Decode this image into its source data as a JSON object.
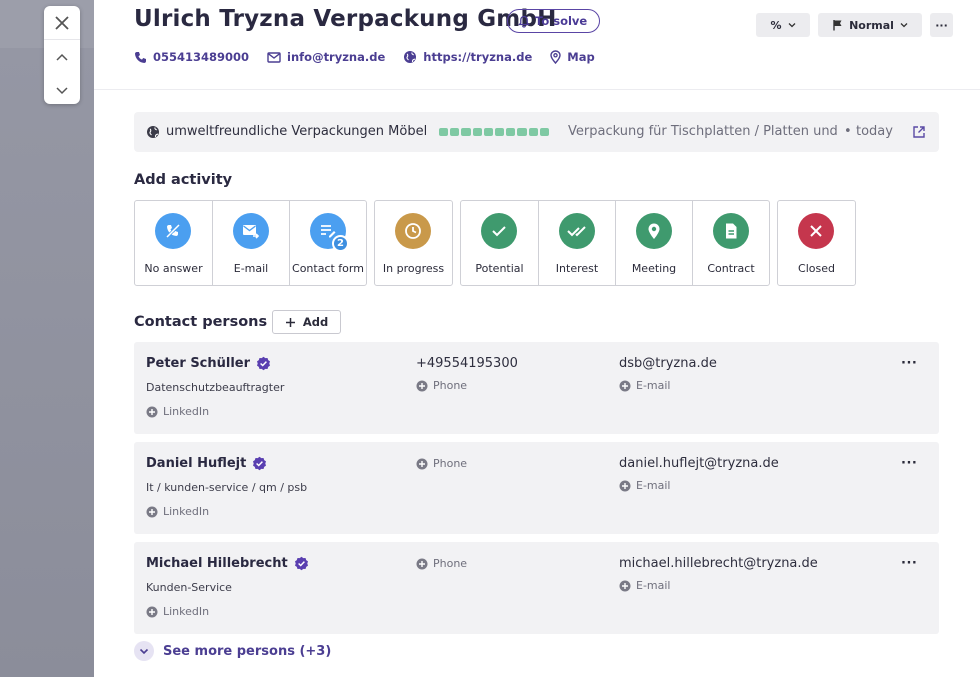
{
  "header": {
    "company_name": "Ulrich Tryzna Verpackung GmbH",
    "status_label": "To solve",
    "percent_label": "%",
    "priority_label": "Normal",
    "more_label": "···",
    "phone": "055413489000",
    "email": "info@tryzna.de",
    "website": "https://tryzna.de",
    "map_label": "Map"
  },
  "source": {
    "label": "umweltfreundliche Verpackungen Möbel",
    "description": "Verpackung für Tischplatten / Platten und E",
    "separator": "•",
    "time": "today",
    "progress_color": "#7fc9a3"
  },
  "activity": {
    "heading": "Add activity",
    "items": [
      {
        "label": "No answer",
        "icon": "phone-missed-icon",
        "color": "#4b9ff0"
      },
      {
        "label": "E-mail",
        "icon": "mail-send-icon",
        "color": "#4b9ff0"
      },
      {
        "label": "Contact form",
        "icon": "form-icon",
        "color": "#4b9ff0",
        "badge": "2"
      },
      {
        "label": "In progress",
        "icon": "clock-icon",
        "color": "#c9994a"
      },
      {
        "label": "Potential",
        "icon": "check-icon",
        "color": "#3f9a6e"
      },
      {
        "label": "Interest",
        "icon": "double-check-icon",
        "color": "#3f9a6e"
      },
      {
        "label": "Meeting",
        "icon": "location-pin-icon",
        "color": "#3f9a6e"
      },
      {
        "label": "Contract",
        "icon": "document-icon",
        "color": "#3f9a6e"
      },
      {
        "label": "Closed",
        "icon": "x-icon",
        "color": "#c5364d"
      }
    ]
  },
  "persons": {
    "heading": "Contact persons",
    "add_label": "Add",
    "list": [
      {
        "name": "Peter Schüller",
        "role": "Datenschutzbeauftragter",
        "linkedin": "LinkedIn",
        "phone_value": "+49554195300",
        "phone_label": "Phone",
        "email_value": "dsb@tryzna.de",
        "email_label": "E-mail"
      },
      {
        "name": "Daniel Huflejt",
        "role": "It / kunden-service / qm / psb",
        "linkedin": "LinkedIn",
        "phone_value": "",
        "phone_label": "Phone",
        "email_value": "daniel.huflejt@tryzna.de",
        "email_label": "E-mail"
      },
      {
        "name": "Michael Hillebrecht",
        "role": "Kunden-Service",
        "linkedin": "LinkedIn",
        "phone_value": "",
        "phone_label": "Phone",
        "email_value": "michael.hillebrecht@tryzna.de",
        "email_label": "E-mail"
      }
    ],
    "see_more": "See more persons (+3)"
  },
  "colors": {
    "brand": "#4b3e92",
    "verified": "#5a3fb0"
  }
}
